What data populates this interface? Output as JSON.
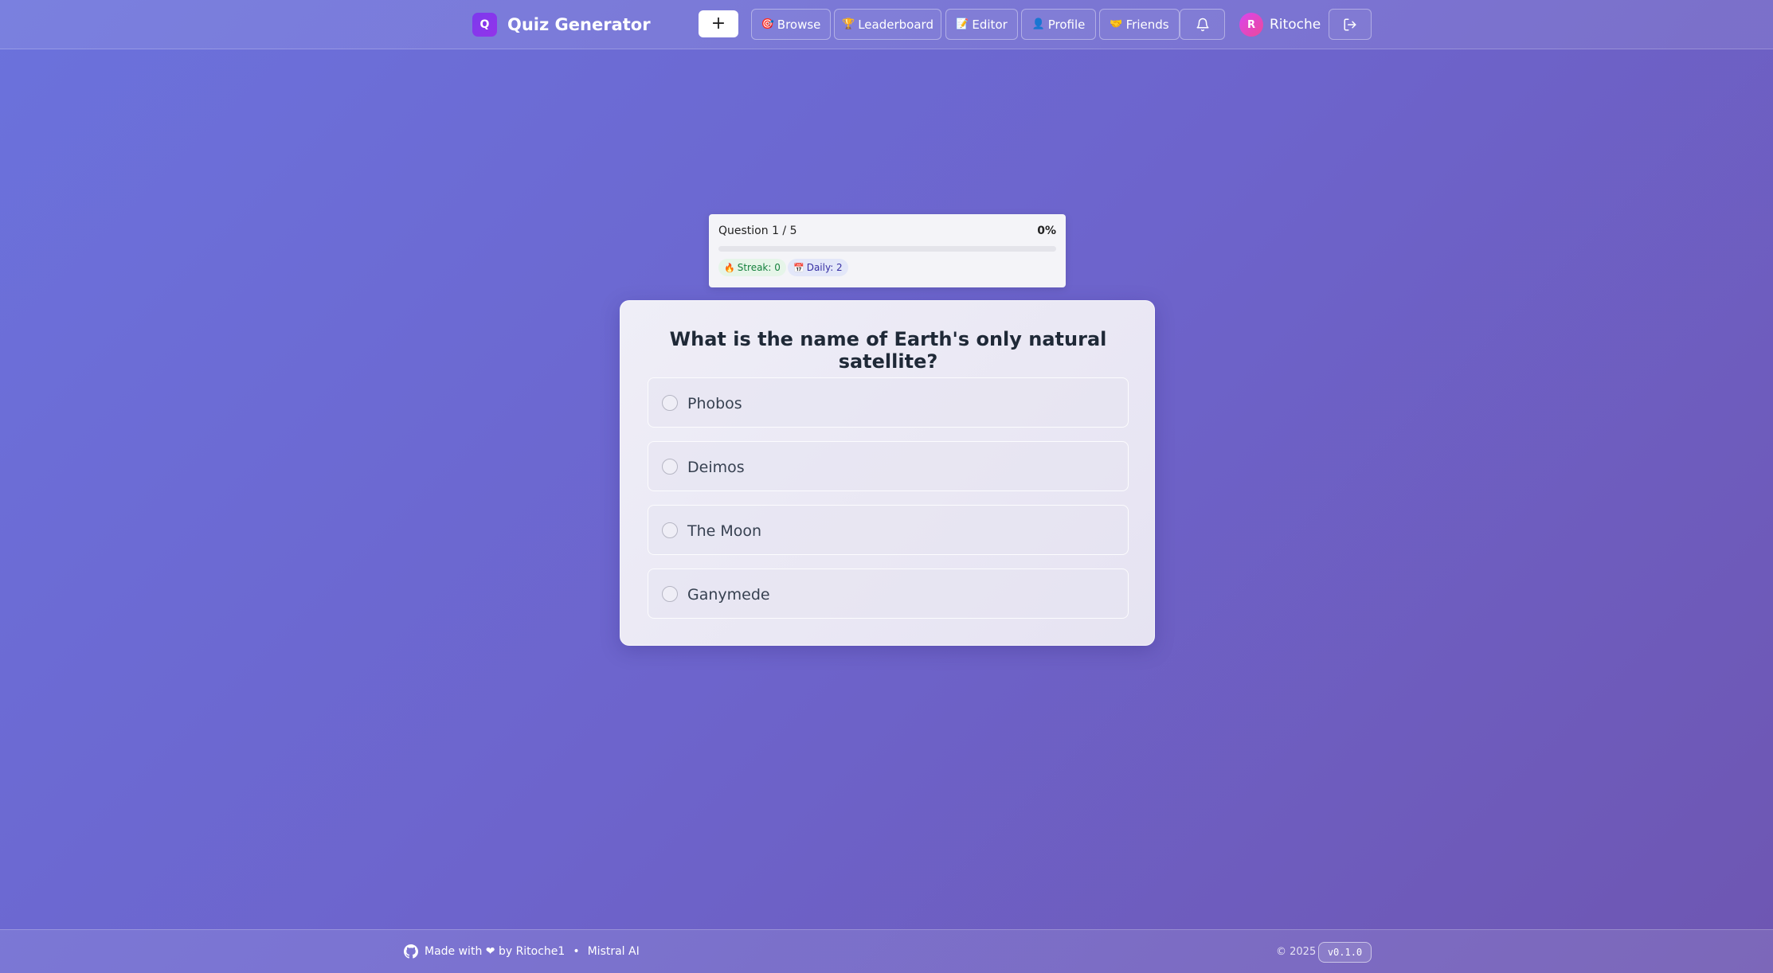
{
  "header": {
    "logo_letter": "Q",
    "app_title": "Quiz Generator",
    "create_label": "+",
    "nav": [
      {
        "icon": "🎯",
        "label": "Browse"
      },
      {
        "icon": "🏆",
        "label": "Leaderboard"
      },
      {
        "icon": "📝",
        "label": "Editor"
      },
      {
        "icon": "👤",
        "label": "Profile"
      },
      {
        "icon": "🤝",
        "label": "Friends"
      }
    ],
    "user": {
      "initial": "R",
      "name": "Ritoche"
    }
  },
  "progress": {
    "counter": "Question 1 / 5",
    "percent_label": "0%",
    "percent_value": 0,
    "streak": {
      "icon": "🔥",
      "label": "Streak: 0"
    },
    "daily": {
      "icon": "📅",
      "label": "Daily: 2"
    }
  },
  "question": {
    "text": "What is the name of Earth's only natural satellite?",
    "options": [
      "Phobos",
      "Deimos",
      "The Moon",
      "Ganymede"
    ],
    "selected": null
  },
  "footer": {
    "made_with": "Made with ❤ by Ritoche1",
    "separator": "•",
    "partner": "Mistral AI",
    "copyright": "© 2025",
    "version": "v0.1.0"
  },
  "colors": {
    "accent": "#6366f1",
    "logo": "#7c3aed",
    "avatar": "#d946ef"
  }
}
